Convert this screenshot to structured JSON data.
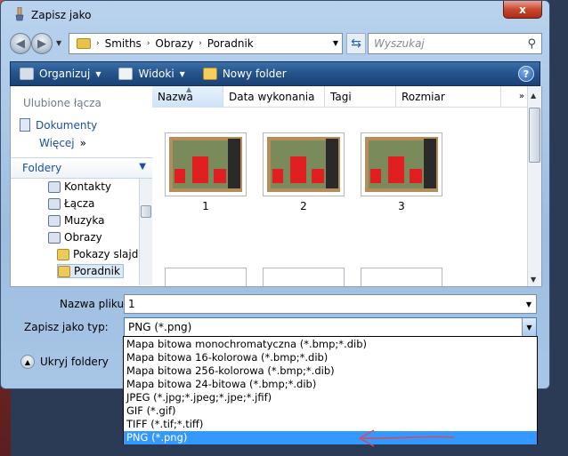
{
  "window": {
    "title": "Zapisz jako",
    "close_label": "x"
  },
  "address_bar": {
    "crumbs": [
      "Smiths",
      "Obrazy",
      "Poradnik"
    ],
    "separator": "›"
  },
  "search": {
    "placeholder": "Wyszukaj"
  },
  "toolbar": {
    "organize_label": "Organizuj",
    "views_label": "Widoki",
    "new_folder_label": "Nowy folder",
    "help_label": "?"
  },
  "left_pane": {
    "favorites_header": "Ulubione łącza",
    "favorites": [
      {
        "label": "Dokumenty"
      },
      {
        "label": "Więcej",
        "suffix": "»"
      }
    ],
    "folders_header": "Foldery",
    "tree": [
      {
        "label": "Kontakty"
      },
      {
        "label": "Łącza"
      },
      {
        "label": "Muzyka"
      },
      {
        "label": "Obrazy"
      },
      {
        "label": "Pokazy slajdó"
      },
      {
        "label": "Poradnik"
      }
    ]
  },
  "file_list": {
    "columns": [
      {
        "label": "Nazwa"
      },
      {
        "label": "Data wykonania"
      },
      {
        "label": "Tagi"
      },
      {
        "label": "Rozmiar"
      }
    ],
    "more_columns": "»",
    "items": [
      {
        "name": "1"
      },
      {
        "name": "2"
      },
      {
        "name": "3"
      }
    ]
  },
  "form": {
    "filename_label": "Nazwa pliku:",
    "filename_value": "1",
    "type_label": "Zapisz jako typ:",
    "type_value": "PNG (*.png)",
    "hide_folders_label": "Ukryj foldery"
  },
  "type_options": [
    "Mapa bitowa monochromatyczna (*.bmp;*.dib)",
    "Mapa bitowa 16-kolorowa  (*.bmp;*.dib)",
    "Mapa bitowa 256-kolorowa (*.bmp;*.dib)",
    "Mapa bitowa 24-bitowa (*.bmp;*.dib)",
    "JPEG (*.jpg;*.jpeg;*.jpe;*.jfif)",
    "GIF (*.gif)",
    "TIFF (*.tif;*.tiff)",
    "PNG (*.png)"
  ],
  "selected_option_index": 7,
  "colors": {
    "toolbar": "#24528a",
    "selection": "#3399ff",
    "annotation_arrow": "#d64a5a"
  }
}
